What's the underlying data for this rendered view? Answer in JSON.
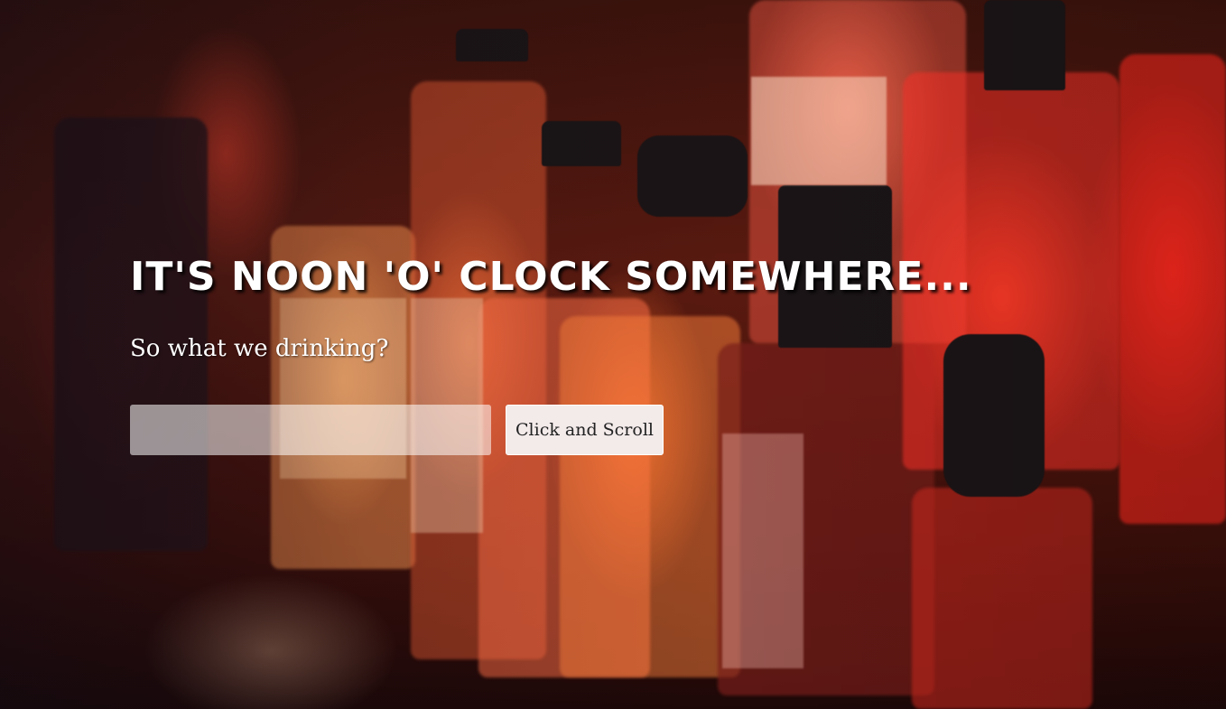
{
  "hero": {
    "background_description": "blurred liquor bottles lit in warm red and orange",
    "accent_colors": [
      "#ff4a2a",
      "#ff8a3c",
      "#1a0a08"
    ]
  },
  "headline": "IT'S NOON 'O' CLOCK SOMEWHERE...",
  "subheadline": "So what we drinking?",
  "search": {
    "value": "",
    "placeholder": ""
  },
  "scroll_button": {
    "label": "Click and Scroll"
  }
}
